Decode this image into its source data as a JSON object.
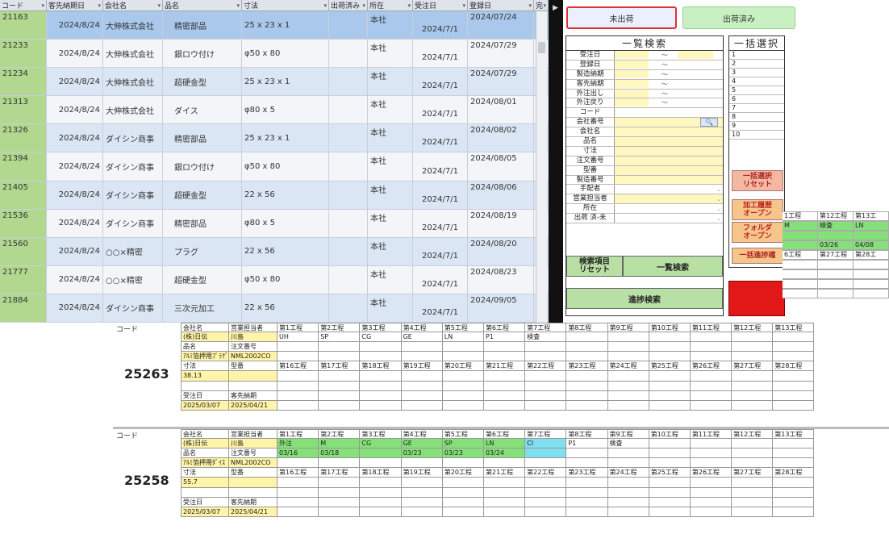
{
  "main_table": {
    "headers": [
      "コード",
      "客先納期日",
      "会社名",
      "品名",
      "寸法",
      "出荷済み",
      "所在",
      "受注日",
      "登録日",
      "完"
    ],
    "rows": [
      {
        "code": "21163",
        "due": "2024/8/24",
        "company": "大伸株式会社",
        "item": "精密部品",
        "size": "25 x 23 x 1",
        "shipped": "",
        "location": "本社",
        "order_date": "2024/7/1",
        "reg_date": "2024/07/24"
      },
      {
        "code": "21233",
        "due": "2024/8/24",
        "company": "大伸株式会社",
        "item": "銀ロウ付け",
        "size": "φ50 x 80",
        "shipped": "",
        "location": "本社",
        "order_date": "2024/7/1",
        "reg_date": "2024/07/29"
      },
      {
        "code": "21234",
        "due": "2024/8/24",
        "company": "大伸株式会社",
        "item": "超硬金型",
        "size": "25 x 23 x 1",
        "shipped": "",
        "location": "本社",
        "order_date": "2024/7/1",
        "reg_date": "2024/07/29"
      },
      {
        "code": "21313",
        "due": "2024/8/24",
        "company": "大伸株式会社",
        "item": "ダイス",
        "size": "φ80 x 5",
        "shipped": "",
        "location": "本社",
        "order_date": "2024/7/1",
        "reg_date": "2024/08/01"
      },
      {
        "code": "21326",
        "due": "2024/8/24",
        "company": "ダイシン商事",
        "item": "精密部品",
        "size": "25 x 23 x 1",
        "shipped": "",
        "location": "本社",
        "order_date": "2024/7/1",
        "reg_date": "2024/08/02"
      },
      {
        "code": "21394",
        "due": "2024/8/24",
        "company": "ダイシン商事",
        "item": "銀ロウ付け",
        "size": "φ50 x 80",
        "shipped": "",
        "location": "本社",
        "order_date": "2024/7/1",
        "reg_date": "2024/08/05"
      },
      {
        "code": "21405",
        "due": "2024/8/24",
        "company": "ダイシン商事",
        "item": "超硬金型",
        "size": "22 x 56",
        "shipped": "",
        "location": "本社",
        "order_date": "2024/7/1",
        "reg_date": "2024/08/06"
      },
      {
        "code": "21536",
        "due": "2024/8/24",
        "company": "ダイシン商事",
        "item": "精密部品",
        "size": "φ80 x 5",
        "shipped": "",
        "location": "本社",
        "order_date": "2024/7/1",
        "reg_date": "2024/08/19"
      },
      {
        "code": "21560",
        "due": "2024/8/24",
        "company": "○○×精密",
        "item": "プラグ",
        "size": "22 x 56",
        "shipped": "",
        "location": "本社",
        "order_date": "2024/7/1",
        "reg_date": "2024/08/20"
      },
      {
        "code": "21777",
        "due": "2024/8/24",
        "company": "○○×精密",
        "item": "超硬金型",
        "size": "φ50 x 80",
        "shipped": "",
        "location": "本社",
        "order_date": "2024/7/1",
        "reg_date": "2024/08/23"
      },
      {
        "code": "21884",
        "due": "2024/8/24",
        "company": "ダイシン商事",
        "item": "三次元加工",
        "size": "22 x 56",
        "shipped": "",
        "location": "本社",
        "order_date": "2024/7/1",
        "reg_date": "2024/09/05"
      }
    ]
  },
  "toggle": {
    "unshipped": "未出荷",
    "shipped": "出荷済み"
  },
  "list_search": {
    "title": "一覧検索",
    "fields": [
      "受注日",
      "登録日",
      "製造納期",
      "客先納期",
      "外注出し",
      "外注戻り",
      "コード",
      "会社番号",
      "会社名",
      "品名",
      "寸法",
      "注文番号",
      "型番",
      "製造番号",
      "手配者",
      "営業担当者",
      "所在",
      "出荷 済-未"
    ],
    "tilde": "～",
    "reset_button": "検索項目\nリセット",
    "search_button": "一覧検索",
    "progress_button": "進捗検索"
  },
  "bulk_select": {
    "title": "一括選択",
    "rows": [
      "1",
      "2",
      "3",
      "4",
      "5",
      "6",
      "7",
      "8",
      "9",
      "10"
    ],
    "reset_button": "一括選択\nリセット",
    "process_history_button": "加工履歴\nオープン",
    "folder_button": "フォルダ\nオープン",
    "bulk_progress_button": "一括進捗確"
  },
  "overlay_grid": {
    "rows": [
      [
        "1工程",
        "第12工程",
        "第13工"
      ],
      [
        "M",
        "検査",
        "LN"
      ],
      [
        "",
        "",
        ""
      ],
      [
        "",
        "03/26",
        "04/08"
      ],
      [
        "6工程",
        "第27工程",
        "第28工"
      ],
      [
        "",
        "",
        ""
      ],
      [
        "",
        "",
        ""
      ],
      [
        "",
        "",
        ""
      ],
      [
        "",
        "",
        ""
      ]
    ]
  },
  "process_blocks": [
    {
      "code_label": "コード",
      "code": "25263",
      "company_label": "会社名",
      "company": "(株)日伝",
      "sales_label": "営業担当者",
      "sales": "川島",
      "item_label": "品名",
      "order_no_label": "注文番号",
      "item": "ｱﾙﾐ箔押用ﾌﾟﾗｸﾞ",
      "order_no": "NML2002CO",
      "size_label": "寸法",
      "model_label": "型番",
      "size": "38.13",
      "recv_label": "受注日",
      "cust_due_label": "客先納期",
      "recv": "2025/03/07",
      "cust_due": "2025/04/21",
      "steps_top": [
        "第1工程",
        "第2工程",
        "第3工程",
        "第4工程",
        "第5工程",
        "第6工程",
        "第7工程",
        "第8工程",
        "第9工程",
        "第10工程",
        "第11工程",
        "第12工程",
        "第13工程"
      ],
      "vals_top": [
        "UH",
        "SP",
        "CG",
        "GE",
        "LN",
        "P1",
        "検査",
        "",
        "",
        "",
        "",
        "",
        ""
      ],
      "dates_top": [
        "",
        "",
        "",
        "",
        "",
        "",
        "",
        "",
        "",
        "",
        "",
        "",
        ""
      ],
      "steps_bottom": [
        "第16工程",
        "第17工程",
        "第18工程",
        "第19工程",
        "第20工程",
        "第21工程",
        "第22工程",
        "第23工程",
        "第24工程",
        "第25工程",
        "第26工程",
        "第27工程",
        "第28工程"
      ]
    },
    {
      "code_label": "コード",
      "code": "25258",
      "company_label": "会社名",
      "company": "(株)日伝",
      "sales_label": "営業担当者",
      "sales": "川島",
      "item_label": "品名",
      "order_no_label": "注文番号",
      "item": "ｱﾙﾐ箔押用ﾀﾞｲｽ",
      "order_no": "NML2002CO",
      "size_label": "寸法",
      "model_label": "型番",
      "size": "55.7",
      "recv_label": "受注日",
      "cust_due_label": "客先納期",
      "recv": "2025/03/07",
      "cust_due": "2025/04/21",
      "steps_top": [
        "第1工程",
        "第2工程",
        "第3工程",
        "第4工程",
        "第5工程",
        "第6工程",
        "第7工程",
        "第8工程",
        "第9工程",
        "第10工程",
        "第11工程",
        "第12工程",
        "第13工程"
      ],
      "vals_top": [
        "外注",
        "M",
        "CG",
        "GE",
        "SP",
        "LN",
        "CI",
        "P1",
        "検査",
        "",
        "",
        "",
        ""
      ],
      "dates_top": [
        "03/16",
        "03/18",
        "",
        "03/23",
        "03/23",
        "03/24",
        "",
        "",
        "",
        "",
        "",
        "",
        ""
      ],
      "steps_bottom": [
        "第16工程",
        "第17工程",
        "第18工程",
        "第19工程",
        "第20工程",
        "第21工程",
        "第22工程",
        "第23工程",
        "第24工程",
        "第25工程",
        "第26工程",
        "第27工程",
        "第28工程"
      ]
    }
  ]
}
